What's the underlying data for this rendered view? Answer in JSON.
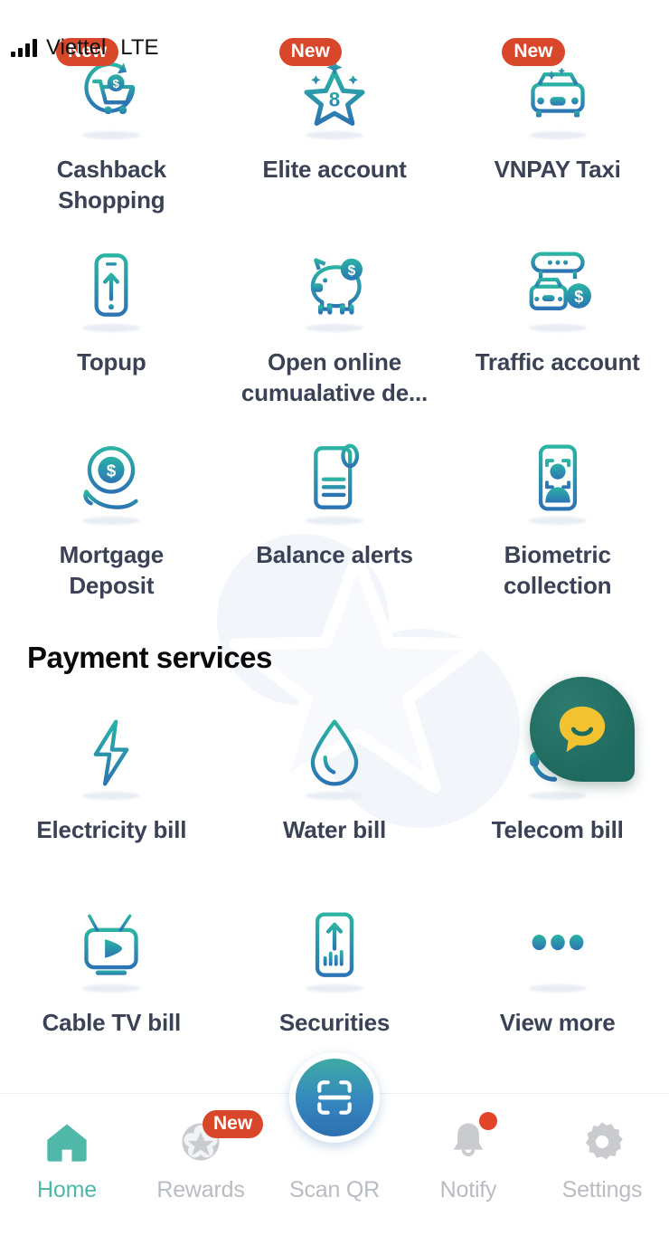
{
  "status_bar": {
    "signal_icon": "signal-bars-icon",
    "carrier": "Viettel",
    "network_type": "LTE"
  },
  "colors": {
    "icon_gradient_start": "#2bb3a4",
    "icon_gradient_end": "#2c74b3",
    "badge_red": "#d9472b",
    "label_text": "#3b4256",
    "heading_text": "#0a0a0a",
    "nav_active": "#4fb8a8",
    "nav_inactive": "#b9bcc2",
    "chat_widget_bg": "#1f6a5e",
    "chat_bubble": "#f2c230",
    "notify_dot": "#e2452a"
  },
  "services_grid": {
    "items": [
      {
        "label": "Cashback Shopping",
        "icon": "cashback-cart-icon",
        "badge": "New"
      },
      {
        "label": "Elite account",
        "icon": "elite-star-icon",
        "badge": "New"
      },
      {
        "label": "VNPAY Taxi",
        "icon": "taxi-icon",
        "badge": "New"
      },
      {
        "label": "Topup",
        "icon": "phone-topup-icon",
        "badge": ""
      },
      {
        "label": "Open online cumualative de...",
        "icon": "piggy-bank-icon",
        "badge": ""
      },
      {
        "label": "Traffic account",
        "icon": "traffic-account-icon",
        "badge": ""
      },
      {
        "label": "Mortgage Deposit",
        "icon": "mortgage-coin-hand-icon",
        "badge": ""
      },
      {
        "label": "Balance alerts",
        "icon": "balance-alert-document-icon",
        "badge": ""
      },
      {
        "label": "Biometric collection",
        "icon": "biometric-face-icon",
        "badge": ""
      }
    ]
  },
  "payment_services": {
    "heading": "Payment services",
    "items": [
      {
        "label": "Electricity bill",
        "icon": "lightning-bolt-icon"
      },
      {
        "label": "Water bill",
        "icon": "water-drop-icon"
      },
      {
        "label": "Telecom bill",
        "icon": "telecom-globe-headset-icon"
      },
      {
        "label": "Cable TV bill",
        "icon": "television-icon"
      },
      {
        "label": "Securities",
        "icon": "securities-chart-icon"
      },
      {
        "label": "View more",
        "icon": "three-dots-icon"
      }
    ]
  },
  "chat_widget": {
    "icon": "chat-smiley-bubble-icon"
  },
  "bottom_nav": {
    "items": [
      {
        "label": "Home",
        "icon": "home-icon",
        "active": true,
        "badge": "",
        "dot": false
      },
      {
        "label": "Rewards",
        "icon": "rewards-flower-icon",
        "active": false,
        "badge": "New",
        "dot": false
      },
      {
        "label": "Scan QR",
        "icon": "qr-scan-icon",
        "active": false,
        "badge": "",
        "dot": false
      },
      {
        "label": "Notify",
        "icon": "bell-icon",
        "active": false,
        "badge": "",
        "dot": true
      },
      {
        "label": "Settings",
        "icon": "gear-icon",
        "active": false,
        "badge": "",
        "dot": false
      }
    ]
  }
}
